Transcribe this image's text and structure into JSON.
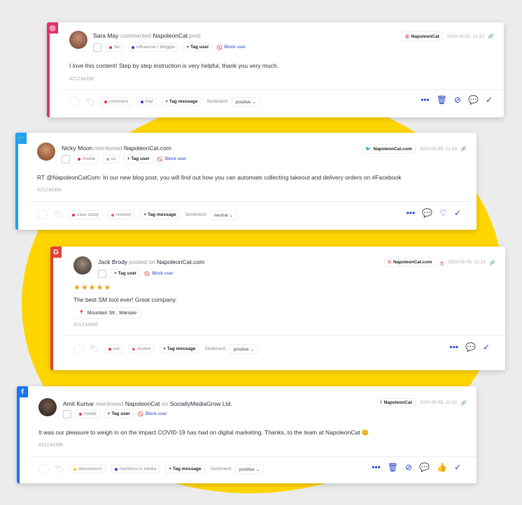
{
  "cards": [
    {
      "network": "instagram",
      "network_color": "#e1306c",
      "author": "Sara May",
      "verb": "commented",
      "target": "NapoleonCat",
      "suffix": "post",
      "tags": [
        {
          "label": "fan",
          "color": "#d83a3a"
        },
        {
          "label": "influencer / blogger",
          "color": "#2240c8"
        }
      ],
      "tag_user": "+ Tag user",
      "block_user": "Block user",
      "text": "I love this content! Step by step instruction is very helpful, thank you very much.",
      "id": "#21234396",
      "foot_tags": [
        {
          "label": "comment",
          "color": "#d83a3a"
        },
        {
          "label": "trial",
          "color": "#2240c8"
        }
      ],
      "tag_message": "+ Tag message",
      "sentiment_label": "Sentiment:",
      "sentiment": "positive",
      "brand": "NapoleonCat",
      "date": "2020-05-05, 21:10"
    },
    {
      "network": "twitter",
      "network_color": "#1da1f2",
      "author": "Nicky Moon",
      "verb": "mentioned",
      "target": "NapoleonCat.com",
      "suffix": "",
      "tags": [
        {
          "label": "media",
          "color": "#d83a3a"
        },
        {
          "label": "us",
          "color": "#aaaaaa"
        }
      ],
      "tag_user": "+ Tag user",
      "block_user": "Block user",
      "text": "RT @NapoleonCatCom: In our new blog post, you will find out how you can automate collecting takeout and delivery orders on #Facebook",
      "id": "#21234396",
      "foot_tags": [
        {
          "label": "case study",
          "color": "#d83a3a"
        },
        {
          "label": "retweet",
          "color": "#e75a9c"
        }
      ],
      "tag_message": "+ Tag message",
      "sentiment_label": "Sentiment:",
      "sentiment": "neutral",
      "brand": "NapoleonCat.com",
      "date": "2020-05-05, 21:10"
    },
    {
      "network": "google",
      "network_color": "#e0433a",
      "author": "Jack Brody",
      "verb": "posted on",
      "target": "NapoleonCat.com",
      "suffix": "",
      "tags": [],
      "tag_user": "+ Tag user",
      "block_user": "Block user",
      "stars": "★★★★★",
      "text": "The best SM tool ever! Great company.",
      "location": "Mountain Str., Warsaw",
      "id": "#21234396",
      "foot_tags": [
        {
          "label": "our",
          "color": "#d83a3a"
        },
        {
          "label": "review",
          "color": "#e75a9c"
        }
      ],
      "tag_message": "+ Tag message",
      "sentiment_label": "Sentiment:",
      "sentiment": "positive",
      "brand": "NapoleonCat.com",
      "date": "2020-05-05, 21:10"
    },
    {
      "network": "facebook",
      "network_color": "#1877f2",
      "author": "Amit Kumar",
      "verb": "mentioned",
      "target": "NapoleonCat",
      "suffix_pre": "on",
      "suffix": "SociallyMediaGrow Ltd.",
      "tags": [
        {
          "label": "media",
          "color": "#d83a3a"
        }
      ],
      "tag_user": "+ Tag user",
      "block_user": "Block user",
      "text": "It was our pleasure to weigh in on the impact COVID-19 has had on digital marketing. Thanks, to the team at NapoleonCat 😊",
      "id": "#21234396",
      "foot_tags": [
        {
          "label": "discussions",
          "color": "#f2c21b"
        },
        {
          "label": "mentions in media",
          "color": "#2240c8"
        }
      ],
      "tag_message": "+ Tag message",
      "sentiment_label": "Sentiment:",
      "sentiment": "positive",
      "brand": "NapoleonCat",
      "date": "2020-05-05, 21:10"
    }
  ]
}
